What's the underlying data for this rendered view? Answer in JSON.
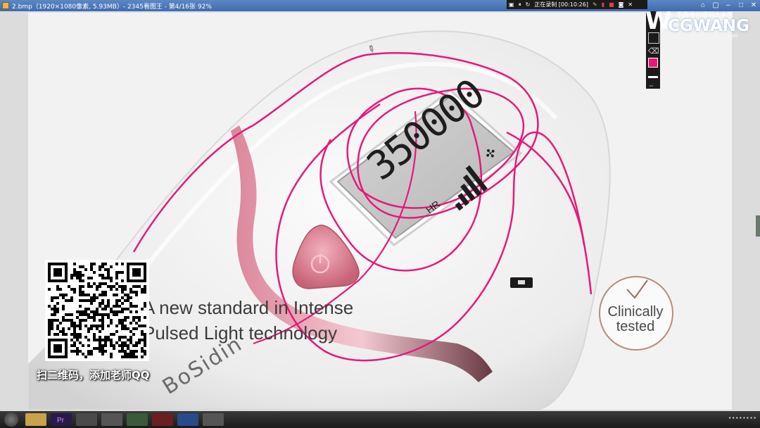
{
  "window": {
    "title": "2.bmp（1920×1080像素, 5.93MB）- 2345看图王 - 第4/16张 92%",
    "controls": [
      "⌂",
      "▢",
      "–",
      "□",
      "✕"
    ]
  },
  "recorder": {
    "status": "正在录制 [00:10:26]"
  },
  "watermark": {
    "brand": "CGWANG",
    "url": ".com",
    "tagline": "平面设计培训大本营"
  },
  "content": {
    "lcd_digits": "350000",
    "lcd_label": "HR",
    "tagline_line1": "A new standard in Intense",
    "tagline_line2": "Pulsed Light technology",
    "badge": "Clinically tested",
    "badge_line1": "Clinically",
    "badge_line2": "tested",
    "product_brand": "BoSidin"
  },
  "qr": {
    "caption": "扫二维码，添加老师QQ"
  },
  "colors": {
    "pen": "#e8187a",
    "accent_pink": "#e07a93",
    "badge_ring": "#b88d78"
  }
}
